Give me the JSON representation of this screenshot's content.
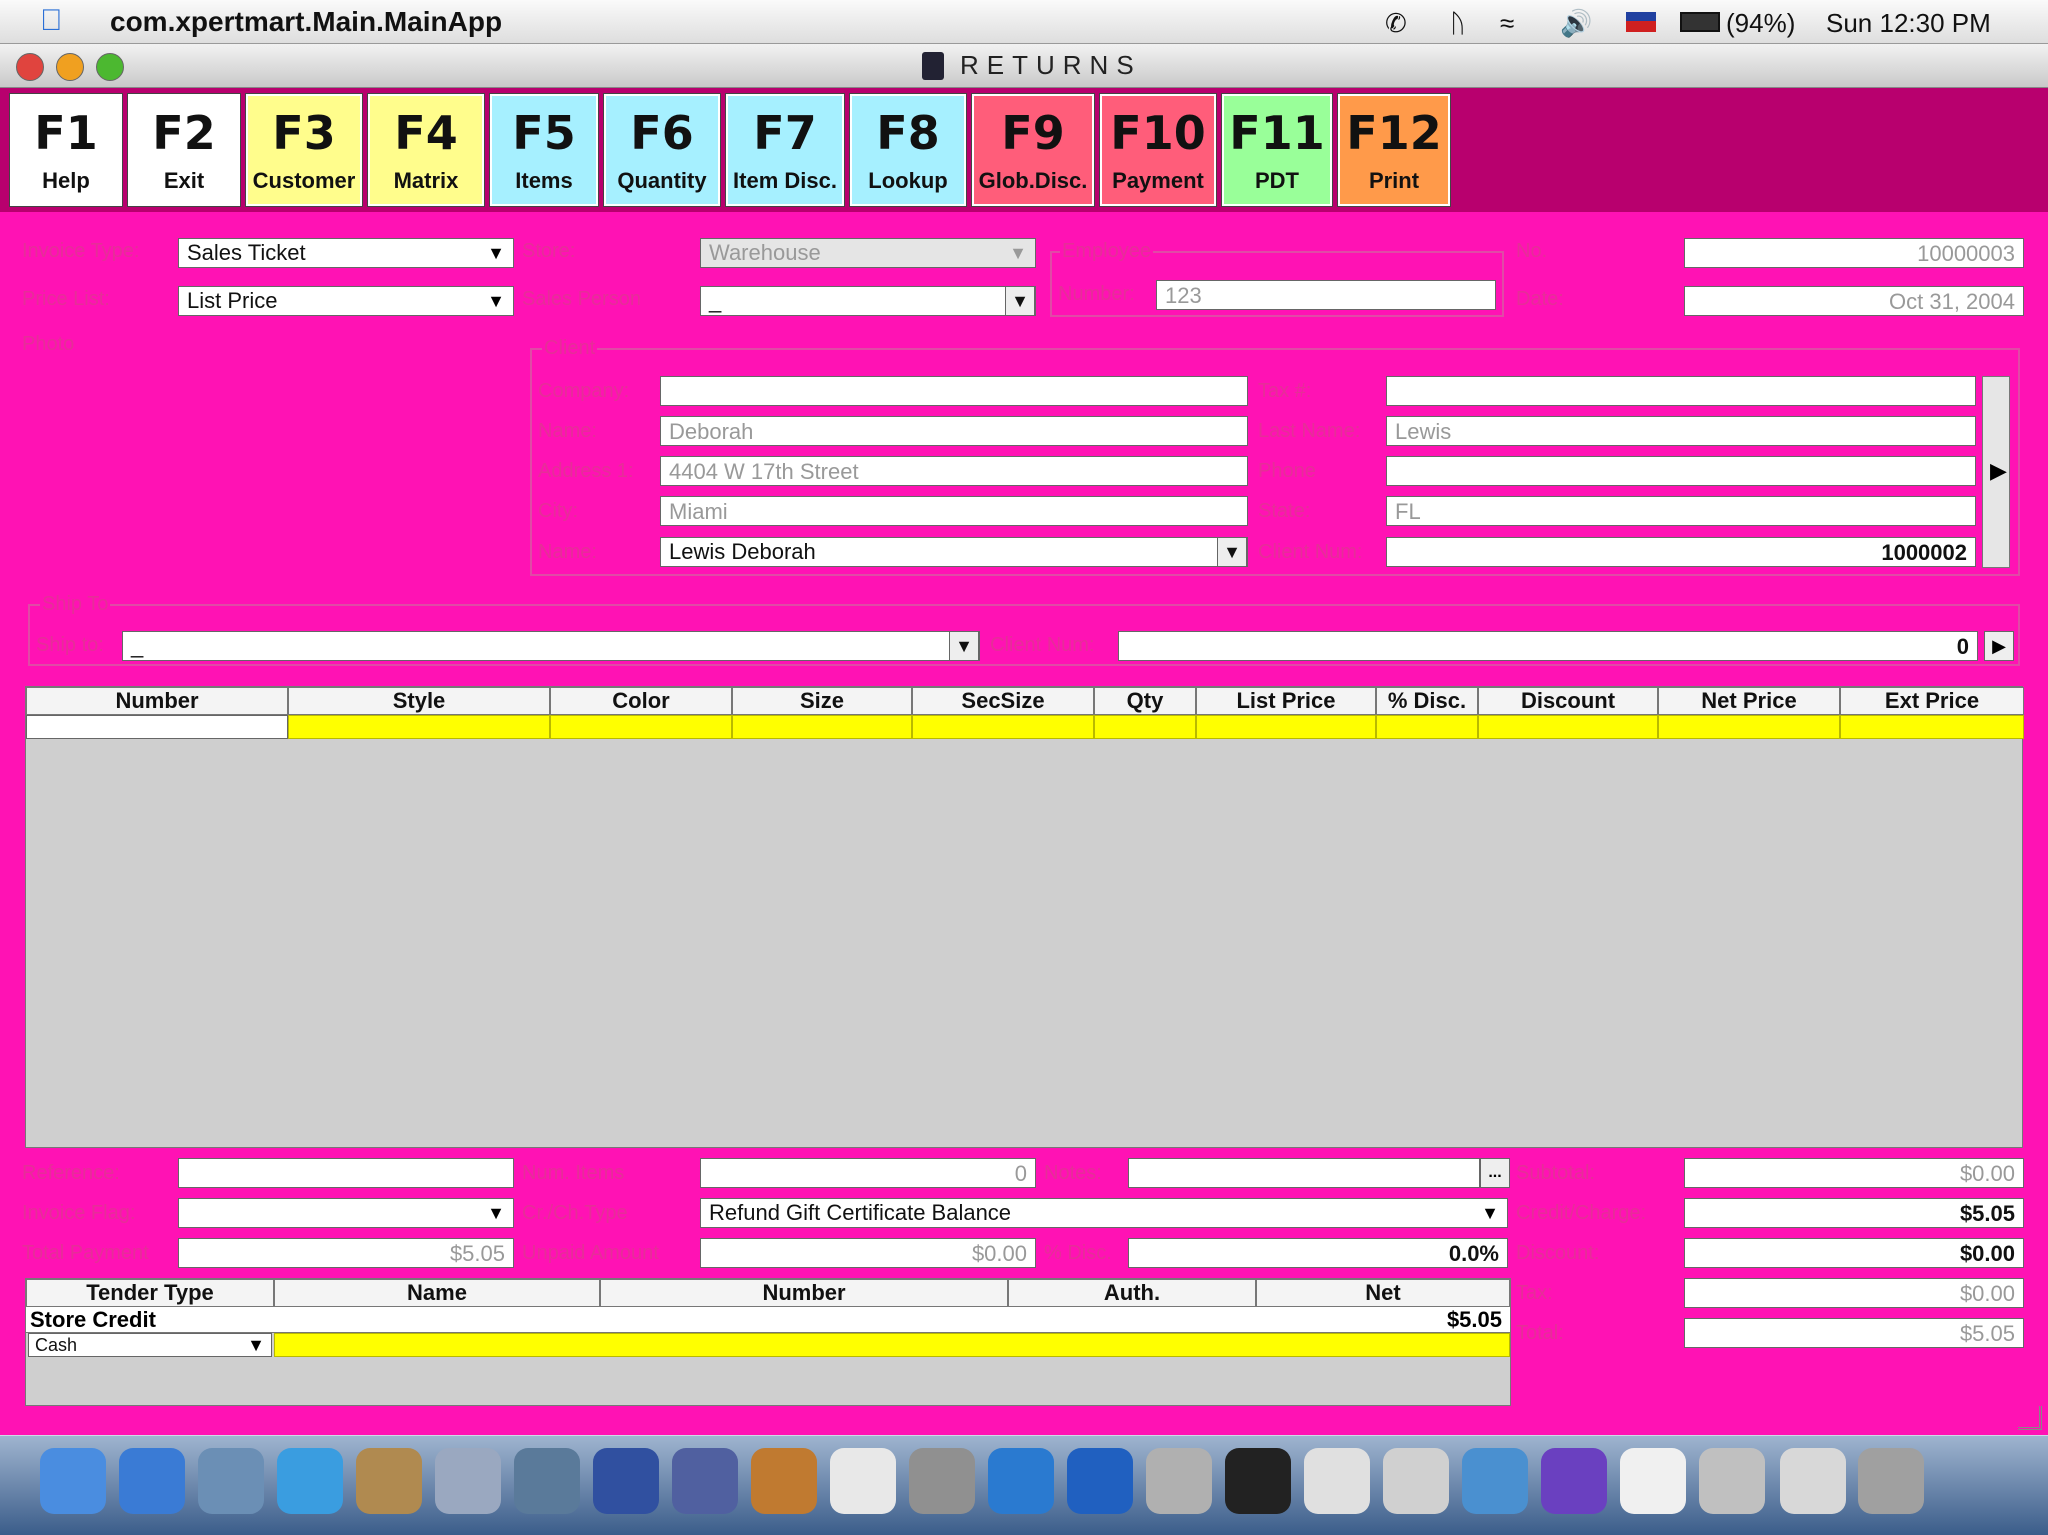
{
  "menubar": {
    "app_name": "com.xpertmart.Main.MainApp",
    "battery": "(94%)",
    "clock": "Sun 12:30 PM"
  },
  "window": {
    "title": "RETURNS"
  },
  "function_keys": [
    {
      "key": "F1",
      "label": "Help",
      "color": "#ffffff"
    },
    {
      "key": "F2",
      "label": "Exit",
      "color": "#ffffff"
    },
    {
      "key": "F3",
      "label": "Customer",
      "color": "#fffd8c"
    },
    {
      "key": "F4",
      "label": "Matrix",
      "color": "#fffd8c"
    },
    {
      "key": "F5",
      "label": "Items",
      "color": "#a6f0ff"
    },
    {
      "key": "F6",
      "label": "Quantity",
      "color": "#a6f0ff"
    },
    {
      "key": "F7",
      "label": "Item Disc.",
      "color": "#a6f0ff"
    },
    {
      "key": "F8",
      "label": "Lookup",
      "color": "#a6f0ff"
    },
    {
      "key": "F9",
      "label": "Glob.Disc.",
      "color": "#ff5d7a"
    },
    {
      "key": "F10",
      "label": "Payment",
      "color": "#ff5d7a"
    },
    {
      "key": "F11",
      "label": "PDT",
      "color": "#99ff99"
    },
    {
      "key": "F12",
      "label": "Print",
      "color": "#ff9a4a"
    }
  ],
  "header": {
    "invoice_type_label": "Invoice Type:",
    "invoice_type_value": "Sales Ticket",
    "price_list_label": "Price List:",
    "price_list_value": "List Price",
    "photo_label": "Photo",
    "store_label": "Store:",
    "store_value": "Warehouse",
    "sales_person_label": "Sales Person",
    "sales_person_value": "_",
    "employee_group": "Employee",
    "employee_number_label": "Number:",
    "employee_number_value": "123",
    "no_label": "No.",
    "no_value": "10000003",
    "date_label": "Date:",
    "date_value": "Oct 31, 2004"
  },
  "client": {
    "group": "Client",
    "company_label": "Company:",
    "company_value": "",
    "tax_label": "Tax #:",
    "tax_value": "",
    "name_label": "Name:",
    "name_value": "Deborah",
    "last_name_label": "Last Name:",
    "last_name_value": "Lewis",
    "address_label": "Address 1:",
    "address_value": "4404 W 17th Street",
    "phone_label": "Phone",
    "phone_value": "",
    "city_label": "City:",
    "city_value": "Miami",
    "state_label": "State:",
    "state_value": "FL",
    "name2_label": "Name:",
    "name2_value": "Lewis Deborah",
    "client_num_label": "Client Num:",
    "client_num_value": "1000002"
  },
  "ship_to": {
    "group": "Ship To",
    "ship_label": "Ship to:",
    "ship_value": "_",
    "client_num_label": "Client Num:",
    "client_num_value": "0"
  },
  "items_table": {
    "columns": [
      "Number",
      "Style",
      "Color",
      "Size",
      "SecSize",
      "Qty",
      "List Price",
      "% Disc.",
      "Discount",
      "Net Price",
      "Ext Price"
    ]
  },
  "footer": {
    "reference_label": "Reference:",
    "reference_value": "",
    "num_items_label": "Num. Items",
    "num_items_value": "0",
    "notes_label": "Notes:",
    "notes_value": "",
    "notes_button": "...",
    "subtotal_label": "Subtotal:",
    "subtotal_value": "$0.00",
    "invoice_flag_label": "Invoice Flag:",
    "invoice_flag_value": "",
    "crch_type_label": "Cr./Ch.Type",
    "crch_type_value": "Refund Gift Certificate Balance",
    "credit_charge_label": "Credit/Charge:",
    "credit_charge_value": "$5.05",
    "total_payment_label": "Total Payment",
    "total_payment_value": "$5.05",
    "unpaid_label": "Unpaid Amount",
    "unpaid_value": "$0.00",
    "pct_disc_label": "% Disc.",
    "pct_disc_value": "0.0%",
    "discount_label": "Discount:",
    "discount_value": "$0.00",
    "tax_label": "Tax:",
    "tax_value": "$0.00",
    "total_label": "Total:",
    "total_value": "$5.05"
  },
  "tender_table": {
    "columns": [
      "Tender Type",
      "Name",
      "Number",
      "Auth.",
      "Net"
    ],
    "rows": [
      {
        "type": "Store Credit",
        "name": "",
        "number": "",
        "auth": "",
        "net": "$5.05"
      }
    ],
    "new_row_type": "Cash"
  },
  "dock_icons": [
    "finder-icon",
    "safari-icon",
    "mail-icon",
    "ichat-icon",
    "address-book-icon",
    "itunes-icon",
    "iphoto-icon",
    "imovie-icon",
    "idvd-icon",
    "garageband-icon",
    "ical-icon",
    "disk-utility-icon",
    "quicktime-icon",
    "internet-explorer-icon",
    "system-preferences-icon",
    "terminal-icon",
    "textedit-icon",
    "printer-icon",
    "users-icon",
    "isync-icon",
    "coffee-icon",
    "mail-at-icon",
    "news-icon",
    "trash-icon"
  ]
}
